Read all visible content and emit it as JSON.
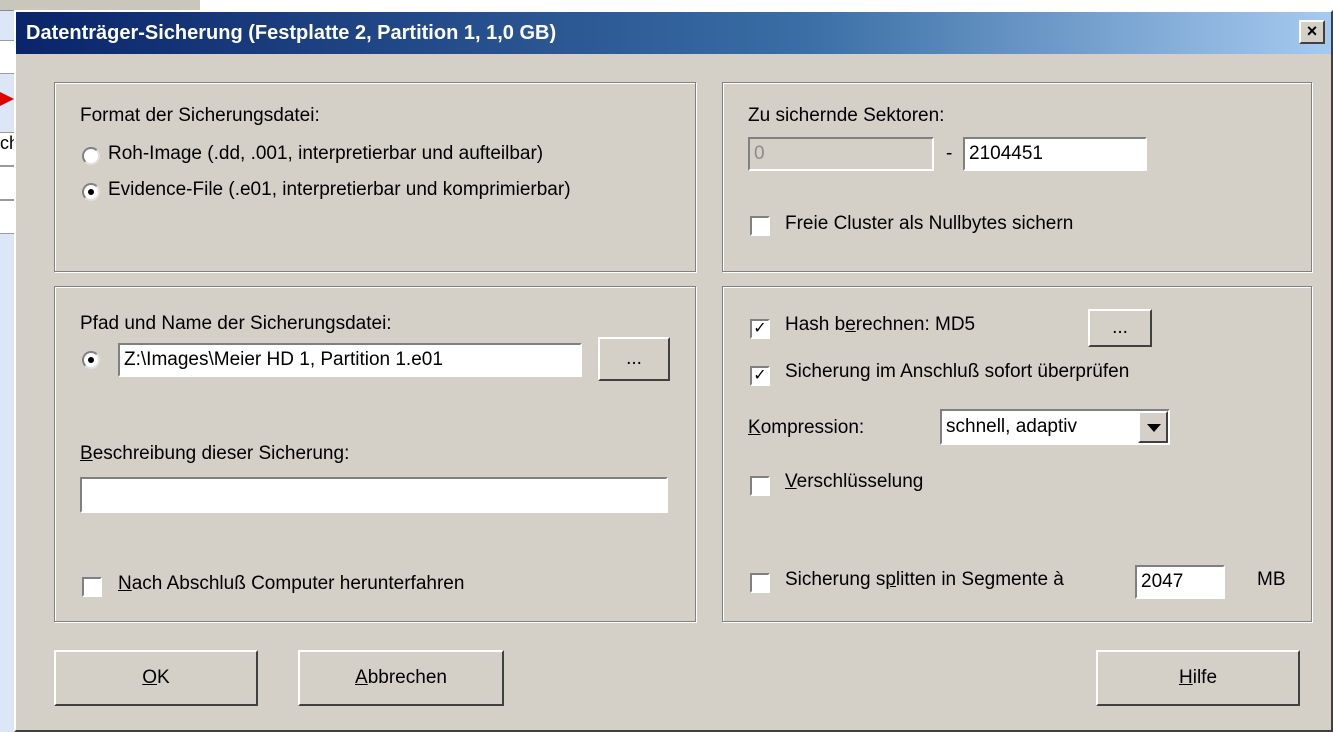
{
  "background": {
    "cell_text": "ch"
  },
  "dialog": {
    "title": "Datenträger-Sicherung (Festplatte 2, Partition 1, 1,0 GB)",
    "close_label": "×"
  },
  "format_group": {
    "heading": "Format der Sicherungsdatei:",
    "options": [
      {
        "label": "Roh-Image (.dd, .001, interpretierbar und aufteilbar)",
        "checked": false
      },
      {
        "label": "Evidence-File (.e01, interpretierbar und komprimierbar)",
        "checked": true
      }
    ]
  },
  "sectors_group": {
    "heading": "Zu sichernde Sektoren:",
    "from_value": "0",
    "dash": "-",
    "to_value": "2104451",
    "free_cluster_label": "Freie Cluster als Nullbytes sichern",
    "free_cluster_checked": false
  },
  "path_group": {
    "heading": "Pfad und Name der Sicherungsdatei:",
    "path_value": "Z:\\Images\\Meier HD 1, Partition 1.e01",
    "browse_label": "...",
    "description_heading_u": "B",
    "description_heading_rest": "eschreibung dieser Sicherung:",
    "description_value": "",
    "shutdown_u": "N",
    "shutdown_rest": "ach Abschluß Computer herunterfahren"
  },
  "options_group": {
    "hash_pre": "Hash b",
    "hash_u": "e",
    "hash_post": "rechnen: MD5",
    "hash_button": "...",
    "verify_label": "Sicherung im Anschluß sofort überprüfen",
    "compression_u": "K",
    "compression_rest": "ompression:",
    "compression_value": "schnell, adaptiv",
    "encryption_u": "V",
    "encryption_rest": "erschlüsselung",
    "split_pre": "Sicherung s",
    "split_u": "p",
    "split_post": "litten in Segmente à",
    "split_value": "2047",
    "split_unit": "MB"
  },
  "buttons": {
    "ok_u": "O",
    "ok_rest": "K",
    "cancel_u": "A",
    "cancel_rest": "bbrechen",
    "help_u": "H",
    "help_rest": "ilfe"
  },
  "colors": {
    "dialog_bg": "#d4d0c8",
    "title_start": "#0a246a",
    "title_end": "#a6caf0"
  }
}
